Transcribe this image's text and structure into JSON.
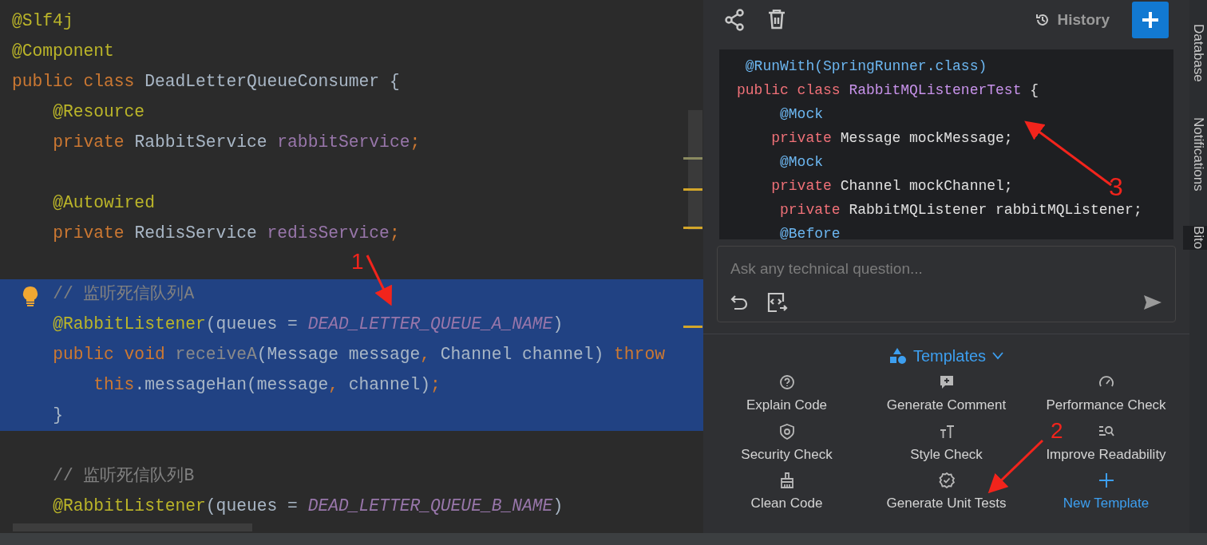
{
  "editor": {
    "lines": [
      {
        "selected": false,
        "tokens": [
          {
            "kind": "annotation",
            "text": "@Slf4j"
          }
        ]
      },
      {
        "selected": false,
        "tokens": [
          {
            "kind": "annotation",
            "text": "@Component"
          }
        ]
      },
      {
        "selected": false,
        "tokens": [
          {
            "kind": "keyword",
            "text": "public class "
          },
          {
            "kind": "plain",
            "text": "DeadLetterQueueConsumer {"
          }
        ]
      },
      {
        "selected": false,
        "tokens": [
          {
            "kind": "annotation",
            "text": "    @Resource"
          }
        ]
      },
      {
        "selected": false,
        "tokens": [
          {
            "kind": "keyword",
            "text": "    private "
          },
          {
            "kind": "plain",
            "text": "RabbitService "
          },
          {
            "kind": "field",
            "text": "rabbitService"
          },
          {
            "kind": "keyword",
            "text": ";"
          }
        ]
      },
      {
        "selected": false
      },
      {
        "selected": false,
        "tokens": [
          {
            "kind": "annotation",
            "text": "    @Autowired"
          }
        ]
      },
      {
        "selected": false,
        "tokens": [
          {
            "kind": "keyword",
            "text": "    private "
          },
          {
            "kind": "plain",
            "text": "RedisService "
          },
          {
            "kind": "field",
            "text": "redisService"
          },
          {
            "kind": "keyword",
            "text": ";"
          }
        ]
      },
      {
        "selected": false
      },
      {
        "selected": true,
        "tokens": [
          {
            "kind": "comment",
            "text": "    // 监听死信队列A"
          }
        ]
      },
      {
        "selected": true,
        "tokens": [
          {
            "kind": "annotation",
            "text": "    @RabbitListener"
          },
          {
            "kind": "plain",
            "text": "(queues = "
          },
          {
            "kind": "constant",
            "text": "DEAD_LETTER_QUEUE_A_NAME"
          },
          {
            "kind": "plain",
            "text": ")"
          }
        ]
      },
      {
        "selected": true,
        "tokens": [
          {
            "kind": "keyword",
            "text": "    public void "
          },
          {
            "kind": "unused",
            "text": "receiveA"
          },
          {
            "kind": "plain",
            "text": "(Message message"
          },
          {
            "kind": "keyword",
            "text": ", "
          },
          {
            "kind": "plain",
            "text": "Channel channel) "
          },
          {
            "kind": "keyword",
            "text": "throw"
          }
        ]
      },
      {
        "selected": true,
        "tokens": [
          {
            "kind": "keyword",
            "text": "        this"
          },
          {
            "kind": "plain",
            "text": ".messageHan(message"
          },
          {
            "kind": "keyword",
            "text": ", "
          },
          {
            "kind": "plain",
            "text": "channel)"
          },
          {
            "kind": "keyword",
            "text": ";"
          }
        ]
      },
      {
        "selected": true,
        "tokens": [
          {
            "kind": "plain",
            "text": "    }"
          }
        ]
      },
      {
        "selected": false
      },
      {
        "selected": false,
        "tokens": [
          {
            "kind": "comment",
            "text": "    // 监听死信队列B"
          }
        ]
      },
      {
        "selected": false,
        "tokens": [
          {
            "kind": "annotation",
            "text": "    @RabbitListener"
          },
          {
            "kind": "plain",
            "text": "(queues = "
          },
          {
            "kind": "constant",
            "text": "DEAD_LETTER_QUEUE_B_NAME"
          },
          {
            "kind": "plain",
            "text": ")"
          }
        ]
      }
    ]
  },
  "assistant": {
    "toolbar": {
      "history": "History"
    },
    "code": [
      {
        "tokens": [
          {
            "kind": "annotation",
            "text": " @RunWith(SpringRunner.class)"
          }
        ]
      },
      {
        "tokens": [
          {
            "kind": "keyword",
            "text": "public class "
          },
          {
            "kind": "type",
            "text": "RabbitMQListenerTest"
          },
          {
            "kind": "plain",
            "text": " {"
          }
        ]
      },
      {
        "tokens": [
          {
            "kind": "annotation",
            "text": "     @Mock"
          }
        ]
      },
      {
        "tokens": [
          {
            "kind": "keyword",
            "text": "    private "
          },
          {
            "kind": "plain",
            "text": "Message mockMessage;"
          }
        ]
      },
      {
        "tokens": [
          {
            "kind": "annotation",
            "text": "     @Mock"
          }
        ]
      },
      {
        "tokens": [
          {
            "kind": "keyword",
            "text": "    private "
          },
          {
            "kind": "plain",
            "text": "Channel mockChannel;"
          }
        ]
      },
      {
        "tokens": [
          {
            "kind": "keyword",
            "text": "     private "
          },
          {
            "kind": "plain",
            "text": "RabbitMQListener rabbitMQListener;"
          }
        ]
      },
      {
        "tokens": [
          {
            "kind": "annotation",
            "text": "     @Before"
          }
        ]
      }
    ],
    "question": {
      "placeholder": "Ask any technical question..."
    },
    "templates": {
      "title": "Templates",
      "items": [
        {
          "kind": "explain",
          "label": "Explain Code"
        },
        {
          "kind": "comment",
          "label": "Generate Comment"
        },
        {
          "kind": "performance",
          "label": "Performance Check"
        },
        {
          "kind": "security",
          "label": "Security Check"
        },
        {
          "kind": "style",
          "label": "Style Check"
        },
        {
          "kind": "readability",
          "label": "Improve Readability"
        },
        {
          "kind": "clean",
          "label": "Clean Code"
        },
        {
          "kind": "tests",
          "label": "Generate Unit Tests"
        },
        {
          "kind": "new",
          "label": "New Template"
        }
      ]
    }
  },
  "side_tabs": [
    {
      "label": "Database",
      "selected": false
    },
    {
      "label": "Notifications",
      "selected": false
    },
    {
      "label": "Bito",
      "selected": true
    }
  ],
  "annotations": [
    {
      "label": "1"
    },
    {
      "label": "2"
    },
    {
      "label": "3"
    }
  ]
}
